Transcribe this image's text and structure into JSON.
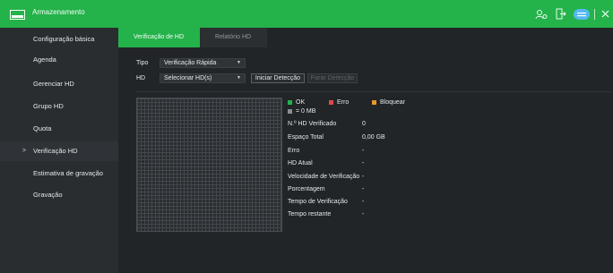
{
  "window": {
    "title": "Armazenamento",
    "accent_color": "#24b24a",
    "icons": [
      "storage-icon",
      "user-icon",
      "logout-icon",
      "menu-icon",
      "close-icon"
    ]
  },
  "sidebar": {
    "items": [
      {
        "label": "Configuração básica"
      },
      {
        "label": "Agenda"
      },
      {
        "label": "Gerenciar HD"
      },
      {
        "label": "Grupo HD"
      },
      {
        "label": "Quota"
      },
      {
        "label": "Verificação HD",
        "active": true
      },
      {
        "label": "Estimativa de gravação"
      },
      {
        "label": "Gravação"
      }
    ]
  },
  "tabs": [
    {
      "label": "Verificação de HD",
      "active": true
    },
    {
      "label": "Relatório HD",
      "active": false
    }
  ],
  "form": {
    "tipo_label": "Tipo",
    "tipo_value": "Verificação Rápida",
    "hd_label": "HD",
    "hd_value": "Selecionar HD(s)",
    "start_button": "Iniciar Detecção",
    "stop_button": "Parar Detecção"
  },
  "legend": {
    "ok": "OK",
    "error": "Erro",
    "blocked": "Bloquear",
    "unit": "= 0 MB",
    "colors": {
      "ok": "#24b24a",
      "error": "#e0474c",
      "blocked": "#e8962b",
      "unit": "#8a9096"
    }
  },
  "info": {
    "rows": [
      {
        "label": "N.º HD Verificado",
        "value": "0"
      },
      {
        "label": "Espaço Total",
        "value": "0,00 GB"
      },
      {
        "label": "Erro",
        "value": "-"
      },
      {
        "label": "HD Atual",
        "value": "-"
      },
      {
        "label": "Velocidade de Verificação",
        "value": "-"
      },
      {
        "label": "Porcentagem",
        "value": "-"
      },
      {
        "label": "Tempo de Verificação",
        "value": "-"
      },
      {
        "label": "Tempo restante",
        "value": "-"
      }
    ]
  }
}
